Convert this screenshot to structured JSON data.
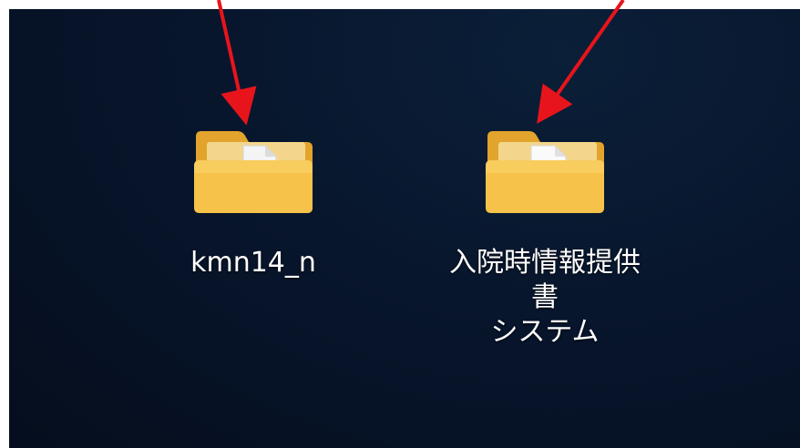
{
  "desktop": {
    "icons": [
      {
        "label": "kmn14_n",
        "icon": "folder-icon",
        "content_glyph": "gear-document"
      },
      {
        "label": "入院時情報提供書\nシステム",
        "icon": "folder-icon",
        "content_glyph": "blank-document"
      }
    ]
  },
  "annotations": {
    "arrows": [
      {
        "color": "#e8141b",
        "target": "kmn14_n"
      },
      {
        "color": "#e8141b",
        "target": "入院時情報提供書システム"
      }
    ]
  },
  "colors": {
    "desktop_background": "#07142a",
    "folder_front": "#f6c24a",
    "folder_back": "#e5a52f",
    "arrow": "#e8141b"
  }
}
